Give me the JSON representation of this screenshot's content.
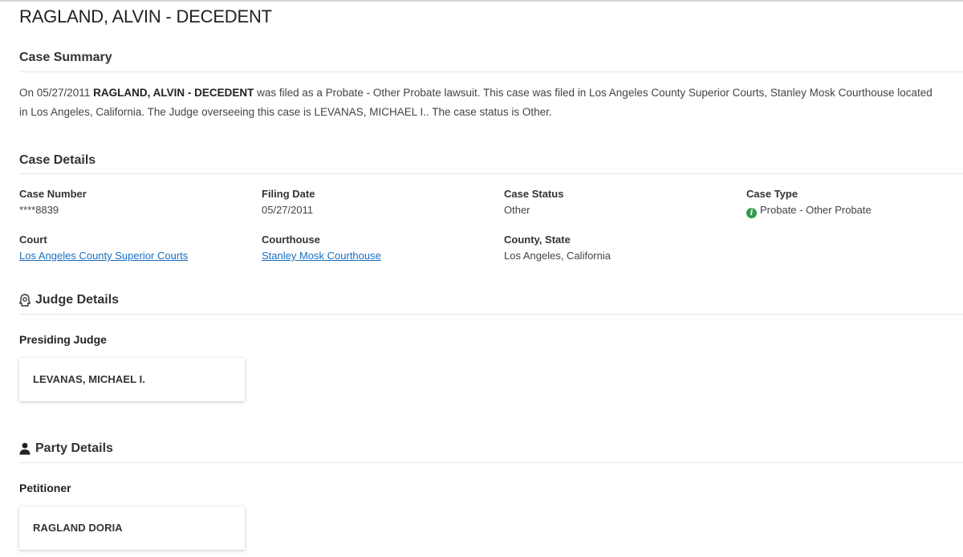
{
  "header": {
    "title": "RAGLAND, ALVIN - DECEDENT"
  },
  "summary": {
    "heading": "Case Summary",
    "text_prefix": "On 05/27/2011 ",
    "case_name": "RAGLAND, ALVIN - DECEDENT",
    "text_suffix": " was filed as a Probate - Other Probate lawsuit. This case was filed in Los Angeles County Superior Courts, Stanley Mosk Courthouse located in Los Angeles, California. The Judge overseeing this case is LEVANAS, MICHAEL I.. The case status is Other."
  },
  "details": {
    "heading": "Case Details",
    "case_number": {
      "label": "Case Number",
      "value": "****8839"
    },
    "filing_date": {
      "label": "Filing Date",
      "value": "05/27/2011"
    },
    "case_status": {
      "label": "Case Status",
      "value": "Other"
    },
    "case_type": {
      "label": "Case Type",
      "value": "Probate - Other Probate",
      "icon": "info-icon",
      "icon_glyph": "i",
      "icon_color": "#2e9d4b"
    },
    "court": {
      "label": "Court",
      "value": "Los Angeles County Superior Courts"
    },
    "courthouse": {
      "label": "Courthouse",
      "value": "Stanley Mosk Courthouse"
    },
    "county_state": {
      "label": "County, State",
      "value": "Los Angeles, California"
    },
    "link_color": "#1a6fc1"
  },
  "judge": {
    "heading": "Judge Details",
    "icon": "judge-icon",
    "presiding_label": "Presiding Judge",
    "presiding_name": "LEVANAS, MICHAEL I."
  },
  "party": {
    "heading": "Party Details",
    "icon": "person-icon",
    "petitioner_label": "Petitioner",
    "petitioner_name": "RAGLAND DORIA"
  }
}
